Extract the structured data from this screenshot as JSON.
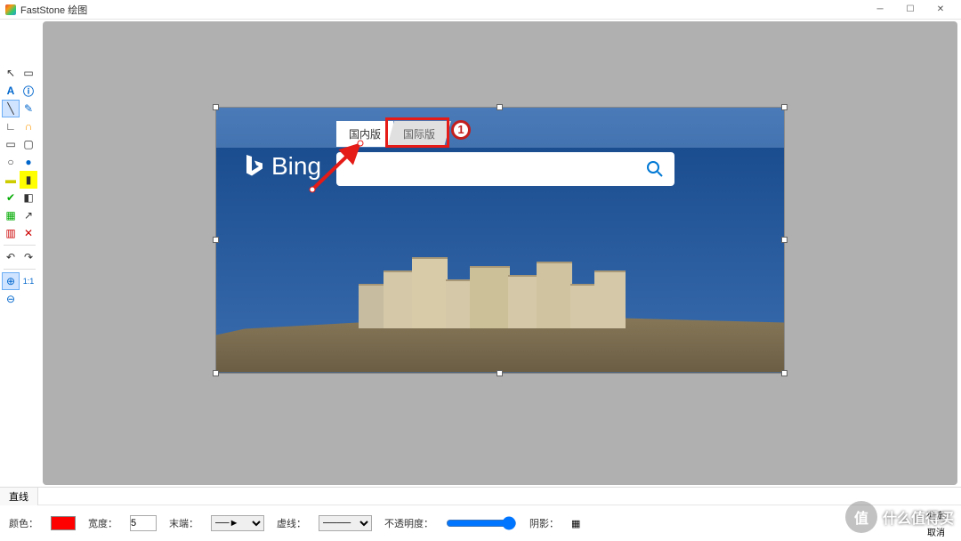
{
  "window": {
    "title": "FastStone 绘图"
  },
  "canvas": {
    "bing": {
      "logo_text": "Bing",
      "tab_domestic": "国内版",
      "tab_international": "国际版",
      "marker_number": "1"
    }
  },
  "bottom": {
    "tab_label": "直线",
    "color_label": "颜色：",
    "width_label": "宽度：",
    "width_value": "5",
    "cap_label": "末端：",
    "dash_label": "虚线：",
    "opacity_label": "不透明度：",
    "shadow_label": "阴影：",
    "ok_label": "确定",
    "cancel_label": "取消"
  },
  "watermark": {
    "badge": "值",
    "text": "什么值得买"
  },
  "tools_left": [
    [
      "pointer",
      "select-rect"
    ],
    [
      "text",
      "info"
    ],
    [
      "line",
      "pencil"
    ],
    [
      "polyline",
      "highlight-line"
    ],
    [
      "rect",
      "rounded-rect"
    ],
    [
      "ellipse",
      "circle"
    ],
    [
      "highlighter",
      "fill-yellow"
    ],
    [
      "marker",
      "eraser"
    ],
    [
      "image",
      "move"
    ],
    [
      "crop",
      "delete"
    ]
  ],
  "tools_bottom": [
    [
      "undo",
      "redo"
    ],
    [
      "zoom-fit",
      "one-to-one"
    ],
    [
      "zoom-out",
      ""
    ]
  ],
  "colors": {
    "annotation_red": "#e41b17"
  }
}
